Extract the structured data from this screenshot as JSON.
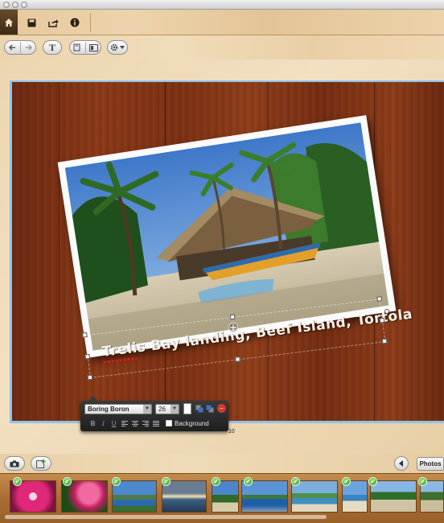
{
  "toolbar": {
    "home_icon": "home-icon",
    "save_icon": "disk-icon",
    "share_icon": "share-icon",
    "info_icon": "info-icon"
  },
  "edit_toolbar": {
    "text_button_label": "T"
  },
  "page": {
    "caption": "Trelis Bay landing, Beef Island, Tortola",
    "page_number": "10"
  },
  "format_bar": {
    "font": "Boring Boron",
    "size": "26",
    "bold": "B",
    "italic": "I",
    "underline": "U",
    "background_label": "Background"
  },
  "bottom_bar": {
    "photos_button": "Photos"
  },
  "filmstrip": {
    "thumbnails": [
      {
        "name": "pink-flower",
        "checked": true
      },
      {
        "name": "pink-flowers",
        "checked": true
      },
      {
        "name": "bay-hills",
        "checked": true
      },
      {
        "name": "sunset-water",
        "checked": true
      },
      {
        "name": "beach-palms",
        "checked": true
      },
      {
        "name": "harbor",
        "checked": true
      },
      {
        "name": "beach-shore",
        "checked": true
      },
      {
        "name": "sea-view",
        "checked": true
      },
      {
        "name": "palm-beach",
        "checked": true
      },
      {
        "name": "palm-huts",
        "checked": true
      },
      {
        "name": "beach-landing",
        "checked": true
      }
    ]
  },
  "colors": {
    "wood_page": "#7a2f12",
    "caption_text": "#f8f1e6",
    "check_green": "#2e9a1e",
    "selection_blue": "#8fc3e6"
  }
}
